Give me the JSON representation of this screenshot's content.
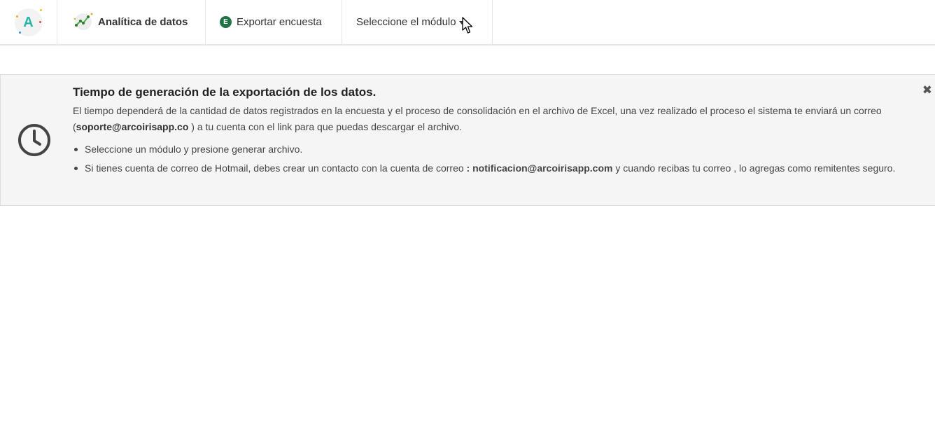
{
  "nav": {
    "brand_letter": "A",
    "analytics_label": "Analítica de datos",
    "export_icon_letter": "E",
    "export_label": "Exportar encuesta",
    "module_label": "Seleccione el módulo"
  },
  "colors": {
    "brand": "#2bb5a8",
    "excel_green": "#217346"
  },
  "alert": {
    "title": "Tiempo de generación de la exportación de los datos.",
    "text_part1": "El tiempo dependerá de la cantidad de datos registrados en la encuesta y el proceso de consolidación en el archivo de Excel, una vez realizado el proceso el sistema te enviará un correo (",
    "support_email": "soporte@arcoirisapp.co",
    "text_part2": " ) a tu cuenta con el link para que puedas descargar el archivo.",
    "bullet1": "Seleccione un módulo y presione generar archivo.",
    "bullet2_part1": "Si tienes cuenta de correo de Hotmail, debes crear un contacto con la cuenta de correo ",
    "bullet2_colon": ":",
    "notification_email": "notificacion@arcoirisapp.com",
    "bullet2_part2": " y cuando recibas tu correo , lo agregas como remitentes seguro.",
    "close_symbol": "✖"
  }
}
